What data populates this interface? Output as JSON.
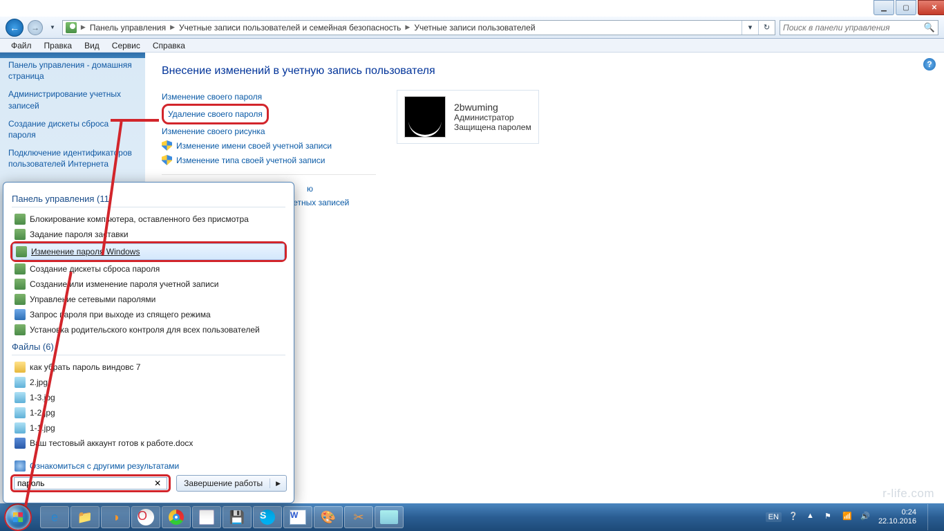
{
  "window_controls": {
    "minimize": "▁",
    "maximize": "▢",
    "close": "✕"
  },
  "nav": {
    "back": "←",
    "fwd": "→",
    "breadcrumb": [
      "Панель управления",
      "Учетные записи пользователей и семейная безопасность",
      "Учетные записи пользователей"
    ],
    "refresh": "↻",
    "search_placeholder": "Поиск в панели управления"
  },
  "menubar": [
    "Файл",
    "Правка",
    "Вид",
    "Сервис",
    "Справка"
  ],
  "sidebar": {
    "links": [
      "Панель управления - домашняя страница",
      "Администрирование учетных записей",
      "Создание дискеты сброса пароля",
      "Подключение идентификаторов пользователей Интернета"
    ]
  },
  "content": {
    "heading": "Внесение изменений в учетную запись пользователя",
    "links": [
      {
        "label": "Изменение своего пароля",
        "shield": false
      },
      {
        "label": "Удаление своего пароля",
        "shield": false,
        "highlight": true
      },
      {
        "label": "Изменение своего рисунка",
        "shield": false
      },
      {
        "label": "Изменение имени своей учетной записи",
        "shield": true
      },
      {
        "label": "Изменение типа своей учетной записи",
        "shield": true
      }
    ],
    "links2": [
      {
        "label": "ю"
      },
      {
        "label": "учетных записей"
      }
    ],
    "user": {
      "name": "2bwuming",
      "role": "Администратор",
      "status": "Защищена паролем"
    }
  },
  "start_menu": {
    "group1": {
      "heading": "Панель управления (11)",
      "items": [
        {
          "label": "Блокирование компьютера, оставленного без присмотра",
          "icon": "green"
        },
        {
          "label": "Задание пароля заставки",
          "icon": "green"
        },
        {
          "label": "Изменение пароля Windows",
          "icon": "green",
          "highlight": true,
          "box": true
        },
        {
          "label": "Создание дискеты сброса пароля",
          "icon": "green"
        },
        {
          "label": "Создание или изменение пароля учетной записи",
          "icon": "green"
        },
        {
          "label": "Управление сетевыми паролями",
          "icon": "green"
        },
        {
          "label": "Запрос пароля при выходе из спящего режима",
          "icon": "blue"
        },
        {
          "label": "Установка родительского контроля для всех пользователей",
          "icon": "green"
        }
      ]
    },
    "group2": {
      "heading": "Файлы (6)",
      "items": [
        {
          "label": "как убрать пароль виндовс 7",
          "icon": "folder"
        },
        {
          "label": "2.jpg",
          "icon": "img"
        },
        {
          "label": "1-3.jpg",
          "icon": "img"
        },
        {
          "label": "1-2.jpg",
          "icon": "img"
        },
        {
          "label": "1-1.jpg",
          "icon": "img"
        },
        {
          "label": "Ваш тестовый аккаунт готов к работе.docx",
          "icon": "doc"
        }
      ]
    },
    "more": "Ознакомиться с другими результатами",
    "search_value": "пароль",
    "clear": "✕",
    "shutdown": "Завершение работы"
  },
  "taskbar": {
    "icons": [
      "ie",
      "folder",
      "wmp",
      "opera",
      "chrome",
      "notepad",
      "save",
      "skype",
      "word",
      "paint",
      "snip",
      "photo"
    ]
  },
  "tray": {
    "lang": "EN",
    "time": "0:24",
    "date": "22.10.2016"
  },
  "watermark": "r-life.com"
}
